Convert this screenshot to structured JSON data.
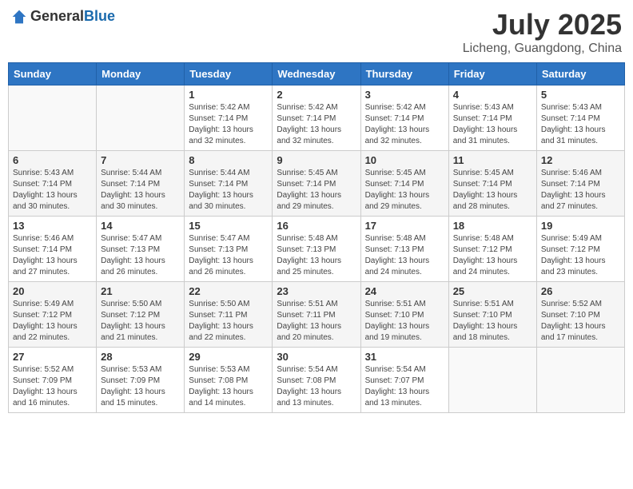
{
  "header": {
    "logo_general": "General",
    "logo_blue": "Blue",
    "month_year": "July 2025",
    "location": "Licheng, Guangdong, China"
  },
  "weekdays": [
    "Sunday",
    "Monday",
    "Tuesday",
    "Wednesday",
    "Thursday",
    "Friday",
    "Saturday"
  ],
  "weeks": [
    [
      {
        "day": "",
        "info": ""
      },
      {
        "day": "",
        "info": ""
      },
      {
        "day": "1",
        "info": "Sunrise: 5:42 AM\nSunset: 7:14 PM\nDaylight: 13 hours and 32 minutes."
      },
      {
        "day": "2",
        "info": "Sunrise: 5:42 AM\nSunset: 7:14 PM\nDaylight: 13 hours and 32 minutes."
      },
      {
        "day": "3",
        "info": "Sunrise: 5:42 AM\nSunset: 7:14 PM\nDaylight: 13 hours and 32 minutes."
      },
      {
        "day": "4",
        "info": "Sunrise: 5:43 AM\nSunset: 7:14 PM\nDaylight: 13 hours and 31 minutes."
      },
      {
        "day": "5",
        "info": "Sunrise: 5:43 AM\nSunset: 7:14 PM\nDaylight: 13 hours and 31 minutes."
      }
    ],
    [
      {
        "day": "6",
        "info": "Sunrise: 5:43 AM\nSunset: 7:14 PM\nDaylight: 13 hours and 30 minutes."
      },
      {
        "day": "7",
        "info": "Sunrise: 5:44 AM\nSunset: 7:14 PM\nDaylight: 13 hours and 30 minutes."
      },
      {
        "day": "8",
        "info": "Sunrise: 5:44 AM\nSunset: 7:14 PM\nDaylight: 13 hours and 30 minutes."
      },
      {
        "day": "9",
        "info": "Sunrise: 5:45 AM\nSunset: 7:14 PM\nDaylight: 13 hours and 29 minutes."
      },
      {
        "day": "10",
        "info": "Sunrise: 5:45 AM\nSunset: 7:14 PM\nDaylight: 13 hours and 29 minutes."
      },
      {
        "day": "11",
        "info": "Sunrise: 5:45 AM\nSunset: 7:14 PM\nDaylight: 13 hours and 28 minutes."
      },
      {
        "day": "12",
        "info": "Sunrise: 5:46 AM\nSunset: 7:14 PM\nDaylight: 13 hours and 27 minutes."
      }
    ],
    [
      {
        "day": "13",
        "info": "Sunrise: 5:46 AM\nSunset: 7:14 PM\nDaylight: 13 hours and 27 minutes."
      },
      {
        "day": "14",
        "info": "Sunrise: 5:47 AM\nSunset: 7:13 PM\nDaylight: 13 hours and 26 minutes."
      },
      {
        "day": "15",
        "info": "Sunrise: 5:47 AM\nSunset: 7:13 PM\nDaylight: 13 hours and 26 minutes."
      },
      {
        "day": "16",
        "info": "Sunrise: 5:48 AM\nSunset: 7:13 PM\nDaylight: 13 hours and 25 minutes."
      },
      {
        "day": "17",
        "info": "Sunrise: 5:48 AM\nSunset: 7:13 PM\nDaylight: 13 hours and 24 minutes."
      },
      {
        "day": "18",
        "info": "Sunrise: 5:48 AM\nSunset: 7:12 PM\nDaylight: 13 hours and 24 minutes."
      },
      {
        "day": "19",
        "info": "Sunrise: 5:49 AM\nSunset: 7:12 PM\nDaylight: 13 hours and 23 minutes."
      }
    ],
    [
      {
        "day": "20",
        "info": "Sunrise: 5:49 AM\nSunset: 7:12 PM\nDaylight: 13 hours and 22 minutes."
      },
      {
        "day": "21",
        "info": "Sunrise: 5:50 AM\nSunset: 7:12 PM\nDaylight: 13 hours and 21 minutes."
      },
      {
        "day": "22",
        "info": "Sunrise: 5:50 AM\nSunset: 7:11 PM\nDaylight: 13 hours and 22 minutes."
      },
      {
        "day": "23",
        "info": "Sunrise: 5:51 AM\nSunset: 7:11 PM\nDaylight: 13 hours and 20 minutes."
      },
      {
        "day": "24",
        "info": "Sunrise: 5:51 AM\nSunset: 7:10 PM\nDaylight: 13 hours and 19 minutes."
      },
      {
        "day": "25",
        "info": "Sunrise: 5:51 AM\nSunset: 7:10 PM\nDaylight: 13 hours and 18 minutes."
      },
      {
        "day": "26",
        "info": "Sunrise: 5:52 AM\nSunset: 7:10 PM\nDaylight: 13 hours and 17 minutes."
      }
    ],
    [
      {
        "day": "27",
        "info": "Sunrise: 5:52 AM\nSunset: 7:09 PM\nDaylight: 13 hours and 16 minutes."
      },
      {
        "day": "28",
        "info": "Sunrise: 5:53 AM\nSunset: 7:09 PM\nDaylight: 13 hours and 15 minutes."
      },
      {
        "day": "29",
        "info": "Sunrise: 5:53 AM\nSunset: 7:08 PM\nDaylight: 13 hours and 14 minutes."
      },
      {
        "day": "30",
        "info": "Sunrise: 5:54 AM\nSunset: 7:08 PM\nDaylight: 13 hours and 13 minutes."
      },
      {
        "day": "31",
        "info": "Sunrise: 5:54 AM\nSunset: 7:07 PM\nDaylight: 13 hours and 13 minutes."
      },
      {
        "day": "",
        "info": ""
      },
      {
        "day": "",
        "info": ""
      }
    ]
  ]
}
